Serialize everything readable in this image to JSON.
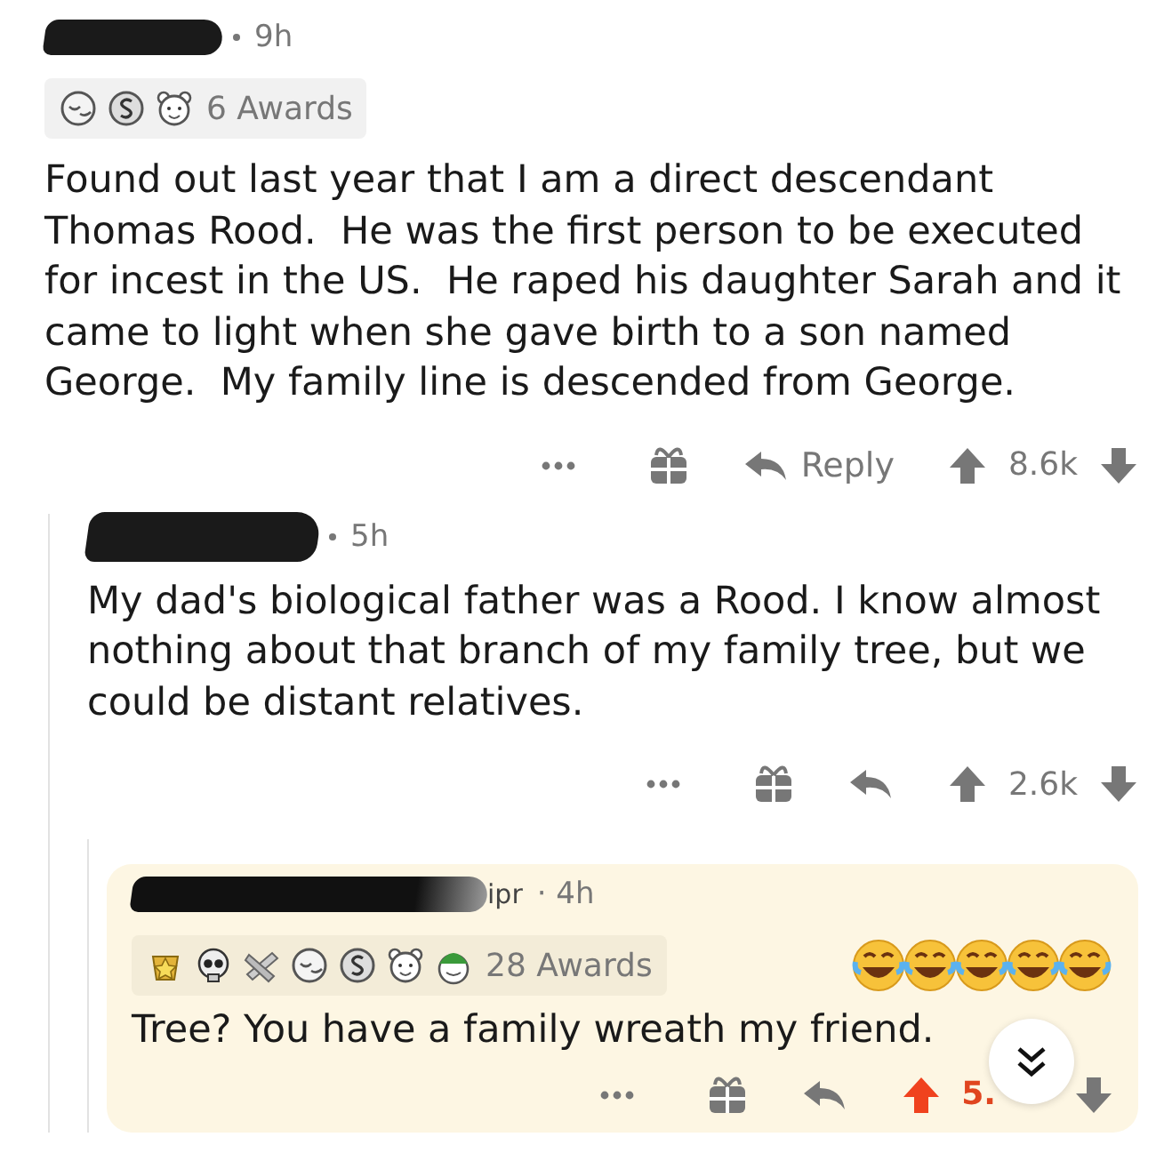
{
  "comments": [
    {
      "age": "9h",
      "awards": {
        "icons": [
          {
            "kind": "sleepy"
          },
          {
            "kind": "coin"
          },
          {
            "kind": "bear"
          }
        ],
        "label": "6 Awards"
      },
      "body": "Found out last year that I am a direct descendant Thomas Rood.  He was the first person to be executed for incest in the US.  He raped his daughter Sarah and it came to light when she gave birth to a son named George.  My family line is descended from George.",
      "reply_label": "Reply",
      "score": "8.6k",
      "upvoted": false,
      "highlighted": false,
      "replies": [
        {
          "age": "5h",
          "body": "My dad's biological father was a Rood. I know almost nothing about that branch of my family tree, but we could be distant relatives.",
          "score": "2.6k",
          "upvoted": false,
          "highlighted": false,
          "replies": [
            {
              "age": "· 4h",
              "username_fragment": "ipr",
              "awards": {
                "icons": [
                  {
                    "kind": "star"
                  },
                  {
                    "kind": "skull"
                  },
                  {
                    "kind": "bandage"
                  },
                  {
                    "kind": "sleepy"
                  },
                  {
                    "kind": "coin"
                  },
                  {
                    "kind": "bear"
                  },
                  {
                    "kind": "elf"
                  }
                ],
                "label": "28 Awards"
              },
              "body": "Tree? You have a family wreath my friend.",
              "score": "5.",
              "upvoted": true,
              "highlighted": true,
              "reactions": [
                {
                  "kind": "laugh"
                },
                {
                  "kind": "laugh"
                },
                {
                  "kind": "laugh"
                },
                {
                  "kind": "laugh"
                },
                {
                  "kind": "laugh"
                }
              ]
            }
          ]
        }
      ]
    }
  ]
}
